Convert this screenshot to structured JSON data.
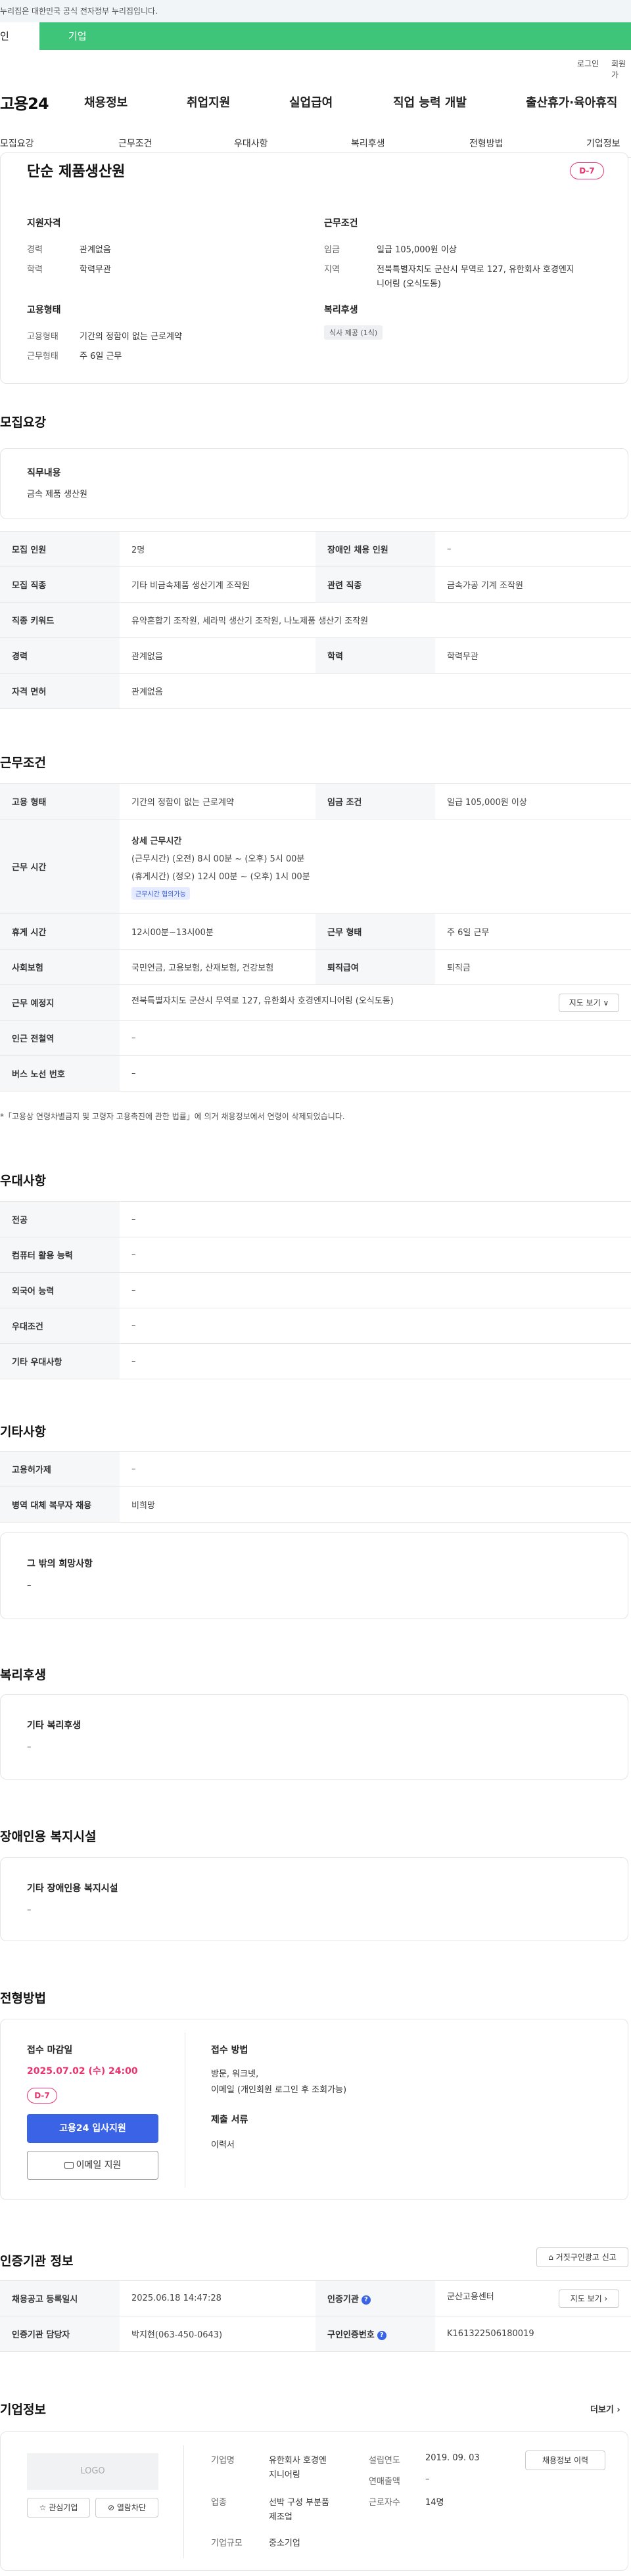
{
  "gov_notice": "누리집은 대한민국 공식 전자정부 누리집입니다.",
  "tabs": {
    "person": "인",
    "company": "기업"
  },
  "util": {
    "login": "로그인",
    "join": "회원가"
  },
  "gnb": {
    "logo": "고용24",
    "items": [
      "채용정보",
      "취업지원",
      "실업급여",
      "직업 능력 개발",
      "출산휴가·육아휴직"
    ]
  },
  "subnav": [
    "모집요강",
    "근무조건",
    "우대사항",
    "복리후생",
    "전형방법",
    "기업정보"
  ],
  "summary": {
    "title": "단순 제품생산원",
    "dday": "D-7",
    "qual_title": "지원자격",
    "career_label": "경력",
    "career_value": "관계없음",
    "edu_label": "학력",
    "edu_value": "학력무관",
    "work_title": "근무조건",
    "wage_label": "임금",
    "wage_value": "일급 105,000원 이상",
    "region_label": "지역",
    "region_value_1": "전북특별자치도 군산시 무역로 127, 유한회사 호경엔지",
    "region_value_2": "니어링 (오식도동)",
    "emp_title": "고용형태",
    "emp_label": "고용형태",
    "emp_value": "기간의 정함이 없는 근로계약",
    "form_label": "근무형태",
    "form_value": "주 6일 근무",
    "welfare_title": "복리후생",
    "welfare_chip": "식사 제공 (1식)"
  },
  "recruit": {
    "section_title": "모집요강",
    "duty_title": "직무내용",
    "duty_value": "금속 제품 생산원",
    "rows": {
      "count_label": "모집 인원",
      "count_value": "2명",
      "disabled_label": "장애인 채용 인원",
      "disabled_value": "–",
      "job_label": "모집 직종",
      "job_value": "기타 비금속제품 생산기계 조작원",
      "related_label": "관련 직종",
      "related_value": "금속가공 기계 조작원",
      "keyword_label": "직종 키워드",
      "keyword_value": "유약혼합기 조작원, 세라믹 생산기 조작원, 나노제품 생산기 조작원",
      "career_label": "경력",
      "career_value": "관계없음",
      "edu_label": "학력",
      "edu_value": "학력무관",
      "license_label": "자격 면허",
      "license_value": "관계없음"
    }
  },
  "work": {
    "section_title": "근무조건",
    "emp_label": "고용 형태",
    "emp_value": "기간의 정함이 없는 근로계약",
    "wage_label": "임금 조건",
    "wage_value": "일급 105,000원 이상",
    "time_label": "근무 시간",
    "time_title": "상세 근무시간",
    "time_line1": "(근무시간) (오전) 8시 00분 ~ (오후) 5시 00분",
    "time_line2": "(휴게시간) (정오) 12시 00분 ~ (오후) 1시 00분",
    "time_badge": "근무시간 협의가능",
    "break_label": "휴게 시간",
    "break_value": "12시00분~13시00분",
    "form_label": "근무 형태",
    "form_value": "주 6일 근무",
    "insurance_label": "사회보험",
    "insurance_value": "국민연금, 고용보험, 산재보험, 건강보험",
    "retire_label": "퇴직급여",
    "retire_value": "퇴직금",
    "place_label": "근무 예정지",
    "place_value": "전북특별자치도 군산시 무역로 127, 유한회사 호경엔지니어링 (오식도동)",
    "map_button": "지도 보기 ∨",
    "subway_label": "인근 전철역",
    "subway_value": "–",
    "bus_label": "버스 노선 번호",
    "bus_value": "–",
    "note": "*「고용상 연령차별금지 및 고령자 고용촉진에 관한 법률」에 의거 채용정보에서 연령이 삭제되었습니다."
  },
  "pref": {
    "section_title": "우대사항",
    "rows": [
      {
        "label": "전공",
        "value": "–"
      },
      {
        "label": "컴퓨터 활용 능력",
        "value": "–"
      },
      {
        "label": "외국어 능력",
        "value": "–"
      },
      {
        "label": "우대조건",
        "value": "–"
      },
      {
        "label": "기타 우대사항",
        "value": "–"
      }
    ]
  },
  "etc": {
    "section_title": "기타사항",
    "rows": [
      {
        "label": "고용허가제",
        "value": "–"
      },
      {
        "label": "병역 대체 복무자 채용",
        "value": "비희망"
      }
    ],
    "wish_title": "그 밖의 희망사항",
    "wish_value": "–"
  },
  "welfare": {
    "section_title": "복리후생",
    "box_title": "기타 복리후생",
    "box_value": "–"
  },
  "facility": {
    "section_title": "장애인용 복지시설",
    "box_title": "기타 장애인용 복지시설",
    "box_value": "–"
  },
  "selection": {
    "section_title": "전형방법",
    "deadline_label": "접수 마감일",
    "deadline_value": "2025.07.02 (수) 24:00",
    "dday": "D-7",
    "apply_button": "고용24 입사지원",
    "email_button": "이메일 지원",
    "method_label": "접수 방법",
    "method_value_1": "방문, 워크넷,",
    "method_value_2": "이메일 (개인회원 로그인 후 조회가능)",
    "docs_label": "제출 서류",
    "docs_value": "이력서"
  },
  "cert": {
    "section_title": "인증기관 정보",
    "report_button": "거짓구인광고 신고",
    "reg_label": "채용공고 등록일시",
    "reg_value": "2025.06.18 14:47:28",
    "org_label": "인증기관",
    "org_value": "군산고용센터",
    "map_button": "지도 보기 ›",
    "manager_label": "인증기관 담당자",
    "manager_value": "박지현(063-450-0643)",
    "num_label": "구인인증번호",
    "num_value": "K161322506180019"
  },
  "company": {
    "section_title": "기업정보",
    "more": "더보기 ›",
    "logo_text": "LOGO",
    "fav_button": "관심기업",
    "block_button": "열람차단",
    "name_label": "기업명",
    "name_value_1": "유한회사 호경엔",
    "name_value_2": "지니어링",
    "industry_label": "업종",
    "industry_value_1": "선박 구성 부분품",
    "industry_value_2": "제조업",
    "size_label": "기업규모",
    "size_value": "중소기업",
    "founded_label": "설립연도",
    "founded_value": "2019. 09. 03",
    "sales_label": "연매출액",
    "sales_value": "–",
    "staff_label": "근로자수",
    "staff_value": "14명",
    "history_button": "채용정보 이력"
  }
}
